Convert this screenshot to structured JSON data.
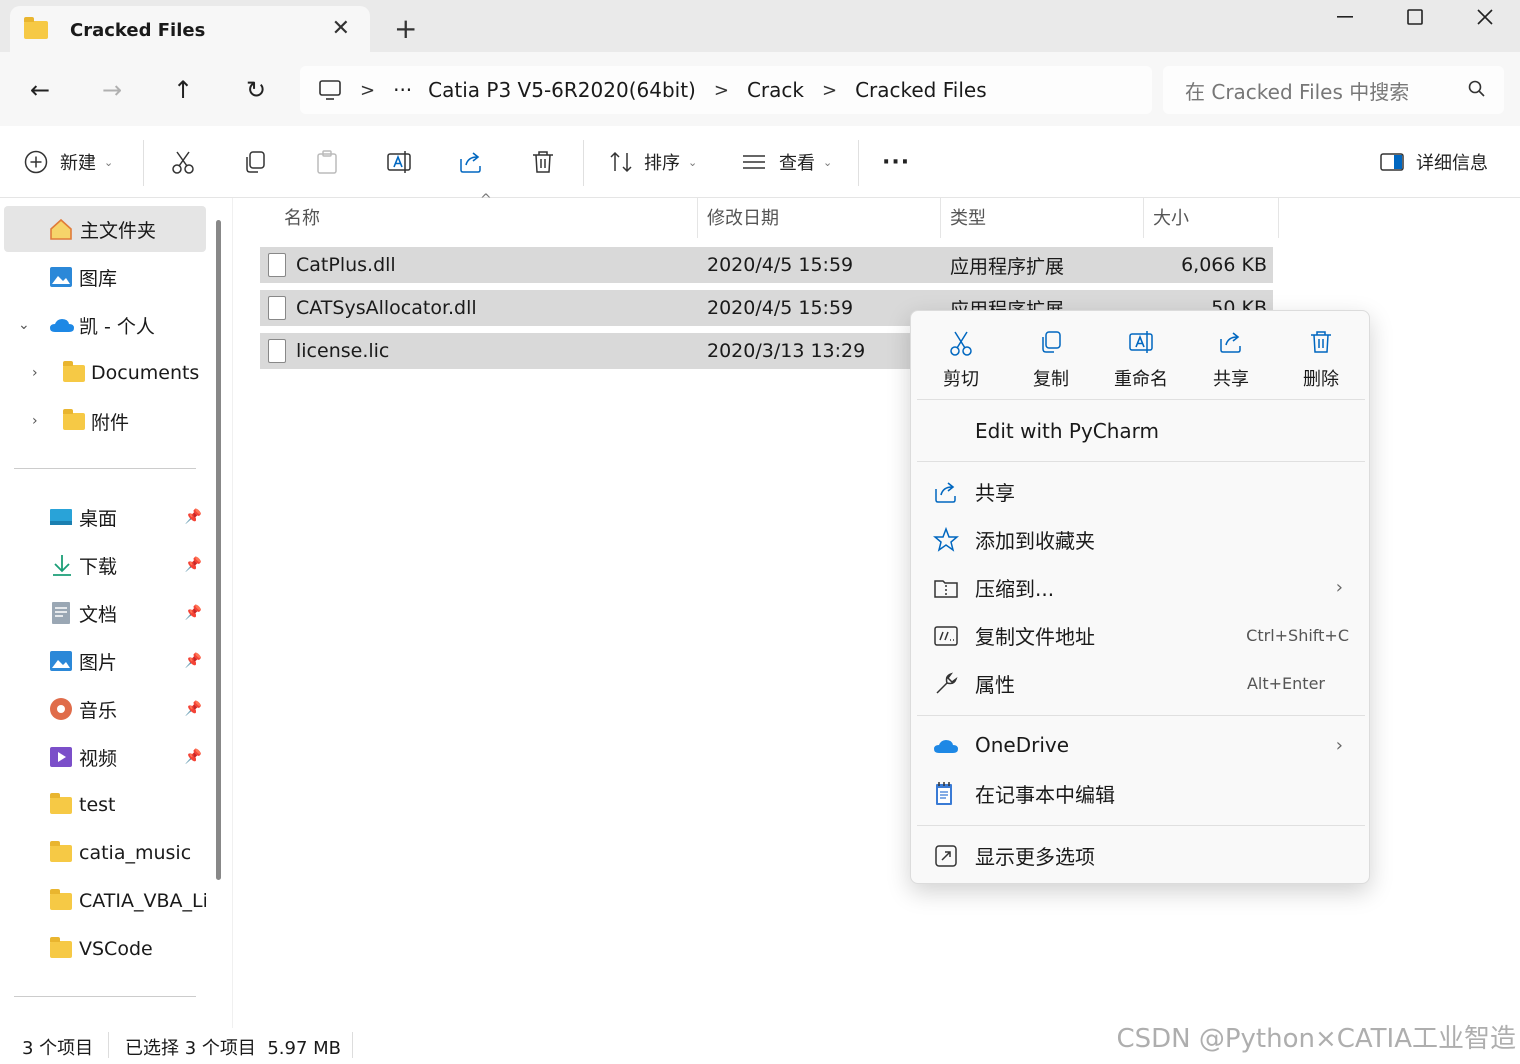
{
  "window": {
    "tab_title": "Cracked Files",
    "new_tab": "+",
    "close_tab": "✕",
    "minimize": "—",
    "maximize": "☐",
    "close": "✕"
  },
  "nav": {
    "back": "←",
    "forward": "→",
    "up": "↑",
    "refresh": "↻",
    "breadcrumb_more": "···",
    "breadcrumbs": [
      "Catia P3 V5-6R2020(64bit)",
      "Crack",
      "Cracked Files"
    ],
    "separator": ">",
    "search_placeholder": "在 Cracked Files 中搜索"
  },
  "commands": {
    "new": "新建",
    "sort": "排序",
    "view": "查看",
    "more": "···",
    "details": "详细信息"
  },
  "sidebar": {
    "home": "主文件夹",
    "gallery": "图库",
    "onedrive": "凯 - 个人",
    "documents": "Documents",
    "attachments": "附件",
    "quick_access": [
      {
        "label": "桌面",
        "pinned": true
      },
      {
        "label": "下载",
        "pinned": true
      },
      {
        "label": "文档",
        "pinned": true
      },
      {
        "label": "图片",
        "pinned": true
      },
      {
        "label": "音乐",
        "pinned": true
      },
      {
        "label": "视频",
        "pinned": true
      },
      {
        "label": "test",
        "pinned": false
      },
      {
        "label": "catia_music",
        "pinned": false
      },
      {
        "label": "CATIA_VBA_Lib",
        "pinned": false
      },
      {
        "label": "VSCode",
        "pinned": false
      }
    ]
  },
  "columns": {
    "name": "名称",
    "modified": "修改日期",
    "type": "类型",
    "size": "大小"
  },
  "files": [
    {
      "name": "CatPlus.dll",
      "modified": "2020/4/5 15:59",
      "type": "应用程序扩展",
      "size": "6,066 KB"
    },
    {
      "name": "CATSysAllocator.dll",
      "modified": "2020/4/5 15:59",
      "type": "应用程序扩展",
      "size": "50 KB"
    },
    {
      "name": "license.lic",
      "modified": "2020/3/13 13:29",
      "type": "",
      "size": ""
    }
  ],
  "context_menu": {
    "quick_actions": [
      "剪切",
      "复制",
      "重命名",
      "共享",
      "删除"
    ],
    "items": {
      "pycharm": "Edit with PyCharm",
      "share": "共享",
      "favorites": "添加到收藏夹",
      "compress": "压缩到...",
      "copy_path": "复制文件地址",
      "copy_path_shortcut": "Ctrl+Shift+C",
      "properties": "属性",
      "properties_shortcut": "Alt+Enter",
      "onedrive": "OneDrive",
      "notepad": "在记事本中编辑",
      "more_options": "显示更多选项"
    }
  },
  "status": {
    "count": "3 个项目",
    "selection": "已选择 3 个项目  5.97 MB"
  },
  "watermark": "CSDN @Python×CATIA工业智造",
  "colors": {
    "accent": "#0067c0",
    "folder": "#f6c945",
    "selection": "#d9d9d9",
    "onedrive": "#1e88e5"
  }
}
